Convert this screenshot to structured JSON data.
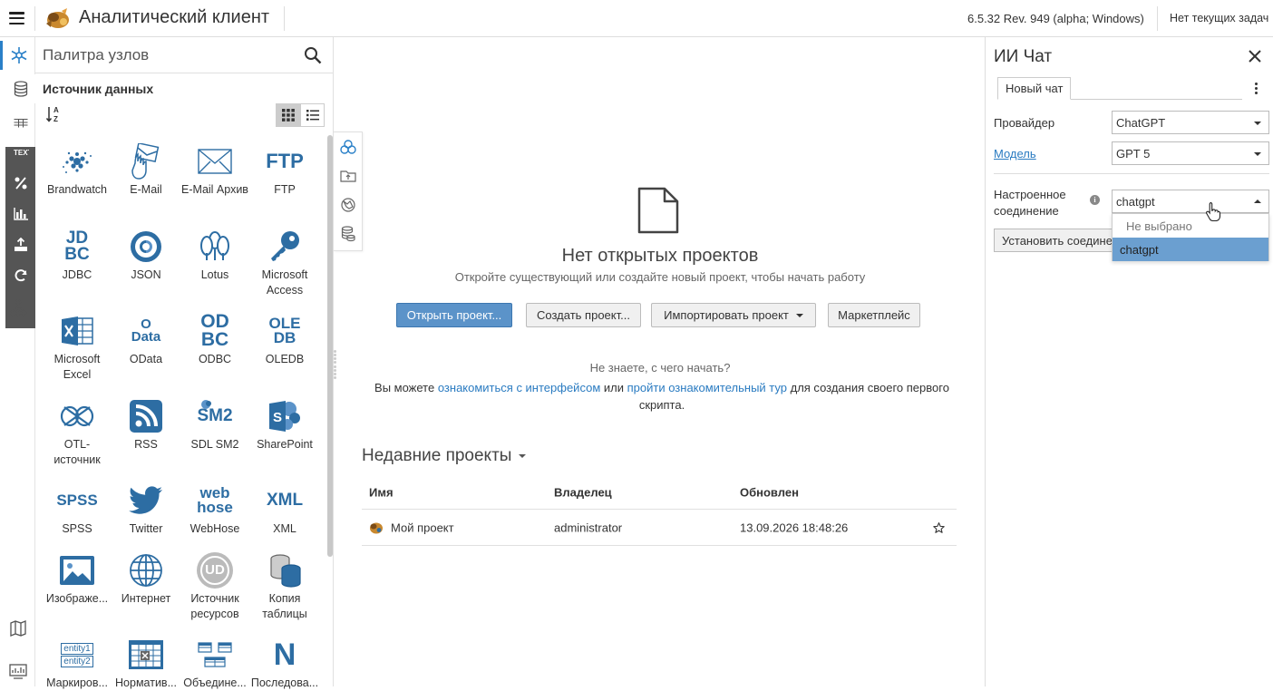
{
  "app": {
    "title": "Аналитический клиент",
    "version": "6.5.32 Rev. 949 (alpha; Windows)",
    "tasks": "Нет текущих задач"
  },
  "rail": {
    "icons": [
      "nodes-icon",
      "database-icon",
      "table-icon",
      "text-icon",
      "percent-icon",
      "bar-chart-icon",
      "upload-icon",
      "refresh-icon",
      "tree-icon",
      "map-icon",
      "dashboard-icon"
    ]
  },
  "palette": {
    "search_placeholder": "Палитра узлов",
    "section": "Источник данных",
    "nodes": [
      {
        "label": "Brandwatch",
        "icon": "brandwatch-icon"
      },
      {
        "label": "E-Mail",
        "icon": "email-hand-icon"
      },
      {
        "label": "E-Mail Архив",
        "icon": "email-archive-icon"
      },
      {
        "label": "FTP",
        "icon": "ftp-icon"
      },
      {
        "label": "JDBC",
        "icon": "jdbc-icon"
      },
      {
        "label": "JSON",
        "icon": "json-icon"
      },
      {
        "label": "Lotus",
        "icon": "lotus-icon"
      },
      {
        "label": "Microsoft Access",
        "icon": "access-key-icon"
      },
      {
        "label": "Microsoft Excel",
        "icon": "excel-icon"
      },
      {
        "label": "OData",
        "icon": "odata-icon"
      },
      {
        "label": "ODBC",
        "icon": "odbc-icon"
      },
      {
        "label": "OLEDB",
        "icon": "oledb-icon"
      },
      {
        "label": "OTL-источник",
        "icon": "otl-icon"
      },
      {
        "label": "RSS",
        "icon": "rss-icon"
      },
      {
        "label": "SDL SM2",
        "icon": "sm2-icon"
      },
      {
        "label": "SharePoint",
        "icon": "sharepoint-icon"
      },
      {
        "label": "SPSS",
        "icon": "spss-icon"
      },
      {
        "label": "Twitter",
        "icon": "twitter-icon"
      },
      {
        "label": "WebHose",
        "icon": "webhose-icon"
      },
      {
        "label": "XML",
        "icon": "xml-icon"
      },
      {
        "label": "Изображе...",
        "icon": "image-icon"
      },
      {
        "label": "Интернет",
        "icon": "globe-icon"
      },
      {
        "label": "Источник ресурсов",
        "icon": "resource-source-icon"
      },
      {
        "label": "Копия таблицы",
        "icon": "table-copy-icon"
      },
      {
        "label": "Маркиров...",
        "icon": "entity-icon"
      },
      {
        "label": "Норматив...",
        "icon": "normative-icon"
      },
      {
        "label": "Объедине...",
        "icon": "merge-icon"
      },
      {
        "label": "Последова...",
        "icon": "sequence-icon"
      }
    ],
    "badges": {
      "ftp": "FTP",
      "jdbc1": "JD",
      "jdbc2": "BC",
      "odata1": "O",
      "odata2": "Data",
      "odbc1": "OD",
      "odbc2": "BC",
      "oledb1": "OLE",
      "oledb2": "DB",
      "sm2": "SM2",
      "spss": "SPSS",
      "web1": "web",
      "web2": "hose",
      "xml": "XML",
      "ud": "UD",
      "entity1": "entity1",
      "entity2": "entity2",
      "seq": "N"
    }
  },
  "main": {
    "empty_title": "Нет открытых проектов",
    "empty_subtitle": "Откройте существующий или создайте новый проект, чтобы начать работу",
    "buttons": {
      "open": "Открыть проект...",
      "create": "Создать проект...",
      "import": "Импортировать проект",
      "market": "Маркетплейс"
    },
    "help_title": "Не знаете, с чего начать?",
    "help_prefix": "Вы можете",
    "help_link1": "ознакомиться с интерфейсом",
    "help_mid": "или",
    "help_link2": "пройти ознакомительный тур",
    "help_suffix": "для создания своего первого скрипта.",
    "recent_title": "Недавние проекты",
    "columns": [
      "Имя",
      "Владелец",
      "Обновлен"
    ],
    "rows": [
      {
        "name": "Мой проект",
        "owner": "administrator",
        "updated": "13.09.2026 18:48:26"
      }
    ]
  },
  "chat": {
    "title": "ИИ Чат",
    "tab": "Новый чат",
    "provider_label": "Провайдер",
    "provider_value": "ChatGPT",
    "model_label": "Модель",
    "model_value": "GPT 5",
    "conn_label_1": "Настроенное",
    "conn_label_2": "соединение",
    "conn_value": "chatgpt",
    "set_button": "Установить соединение",
    "dropdown_options": [
      "Не выбрано",
      "chatgpt"
    ],
    "info": "i"
  },
  "colors": {
    "accent": "#2a80c8",
    "icon_blue": "#2d6da3",
    "primary_button": "#5b93c9",
    "dropdown_selected": "#6b9fd0"
  }
}
